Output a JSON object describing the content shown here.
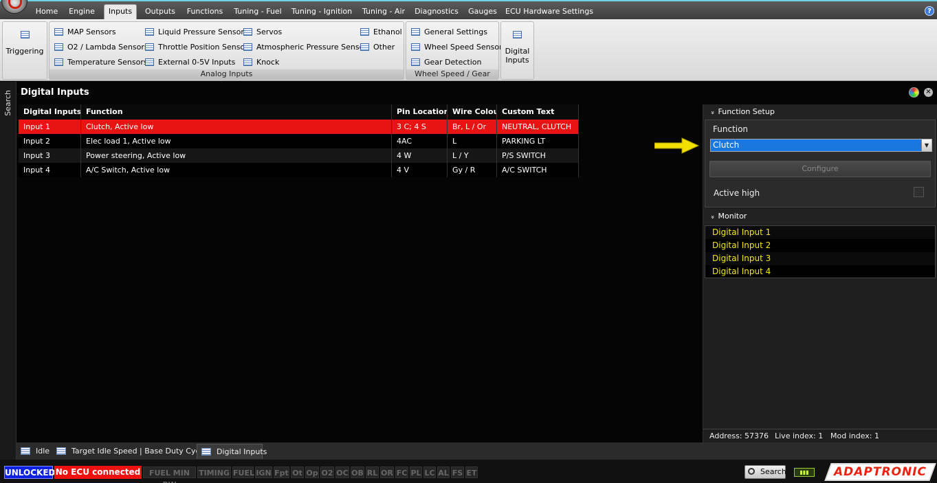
{
  "menu": {
    "tabs": [
      "Home",
      "Engine",
      "Inputs",
      "Outputs",
      "Functions",
      "Tuning - Fuel",
      "Tuning - Ignition",
      "Tuning - Air",
      "Diagnostics",
      "Gauges",
      "ECU Hardware Settings"
    ],
    "active": "Inputs",
    "help": "?"
  },
  "ribbon": {
    "triggering": "Triggering",
    "analog_caption": "Analog Inputs",
    "analog": {
      "col1": [
        "MAP Sensors",
        "O2 / Lambda Sensors",
        "Temperature Sensors"
      ],
      "col2": [
        "Liquid Pressure Sensors",
        "Throttle Position Sensor",
        "External 0-5V Inputs"
      ],
      "col3": [
        "Servos",
        "Atmospheric Pressure Sensor",
        "Knock"
      ],
      "col4": [
        "Ethanol",
        "Other"
      ]
    },
    "wheel_caption": "Wheel Speed / Gear",
    "wheel": [
      "General Settings",
      "Wheel Speed Sensor",
      "Gear Detection"
    ],
    "digital_inputs_line1": "Digital",
    "digital_inputs_line2": "Inputs"
  },
  "side": {
    "search": "Search"
  },
  "panel": {
    "title": "Digital Inputs"
  },
  "table": {
    "headers": [
      "Digital Inputs",
      "Function",
      "Pin Location",
      "Wire Colour",
      "Custom Text"
    ],
    "rows": [
      [
        "Input 1",
        "Clutch, Active low",
        "3 C; 4 S",
        "Br, L / Or",
        "NEUTRAL, CLUTCH"
      ],
      [
        "Input 2",
        "Elec load 1, Active low",
        "4AC",
        "L",
        "PARKING LT"
      ],
      [
        "Input 3",
        "Power steering, Active low",
        "4 W",
        "L / Y",
        "P/S SWITCH"
      ],
      [
        "Input 4",
        "A/C Switch, Active low",
        "4 V",
        "Gy / R",
        "A/C SWITCH"
      ]
    ],
    "selected_row": 0
  },
  "function_setup": {
    "header": "Function Setup",
    "function_label": "Function",
    "function_value": "Clutch",
    "configure": "Configure",
    "active_high_label": "Active high",
    "active_high": false
  },
  "monitor": {
    "header": "Monitor",
    "items": [
      "Digital Input 1",
      "Digital Input 2",
      "Digital Input 3",
      "Digital Input 4"
    ]
  },
  "info": {
    "address": "Address: 57376",
    "live_index": "Live index: 1",
    "mod_index": "Mod index: 1"
  },
  "bottom_tabs": [
    "Idle",
    "Target Idle Speed | Base Duty Cycle",
    "Digital Inputs"
  ],
  "bottom_active": "Digital Inputs",
  "status": {
    "unlocked": "UNLOCKED",
    "ecu": "No ECU connected",
    "flags": [
      "FUEL MIN PW",
      "TIMING",
      "FUEL",
      "IGN",
      "Fpt",
      "Ot",
      "Op",
      "O2",
      "OC",
      "OB",
      "RL",
      "OR",
      "FC",
      "PL",
      "LC",
      "AL",
      "FS",
      "ET"
    ],
    "search": "Search",
    "brand": "ADAPTRONIC"
  },
  "colors": {
    "selected_row": "#e81313",
    "monitor_text": "#f4e81b",
    "unlocked_bg": "#0c22e0",
    "no_ecu_bg": "#ef1010",
    "select_bg": "#1877e0",
    "arrow": "#f2e000"
  }
}
